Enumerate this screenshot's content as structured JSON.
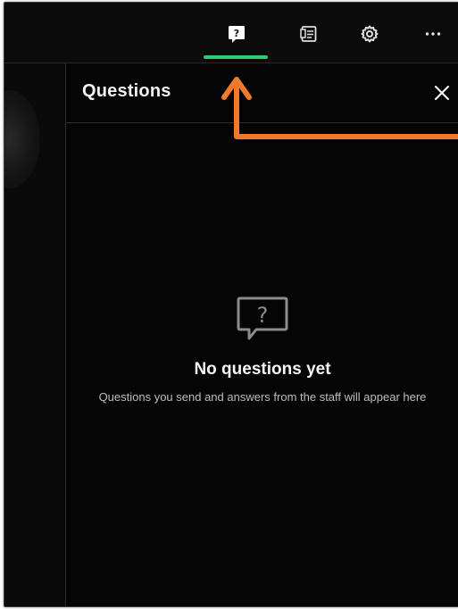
{
  "toolbar": {
    "buttons": [
      {
        "name": "questions",
        "icon": "question-bubble-icon",
        "active": true
      },
      {
        "name": "notes",
        "icon": "notes-icon",
        "active": false
      },
      {
        "name": "settings",
        "icon": "gear-icon",
        "active": false
      },
      {
        "name": "more",
        "icon": "more-horizontal-icon",
        "active": false
      }
    ],
    "active_indicator_color": "#2ecc71"
  },
  "panel": {
    "title": "Questions",
    "close_icon": "close-icon"
  },
  "empty_state": {
    "icon": "question-bubble-icon",
    "title": "No questions yet",
    "description": "Questions you send and answers from the staff will appear here"
  },
  "annotation": {
    "icon": "arrow-icon",
    "color": "#f07a2a"
  }
}
